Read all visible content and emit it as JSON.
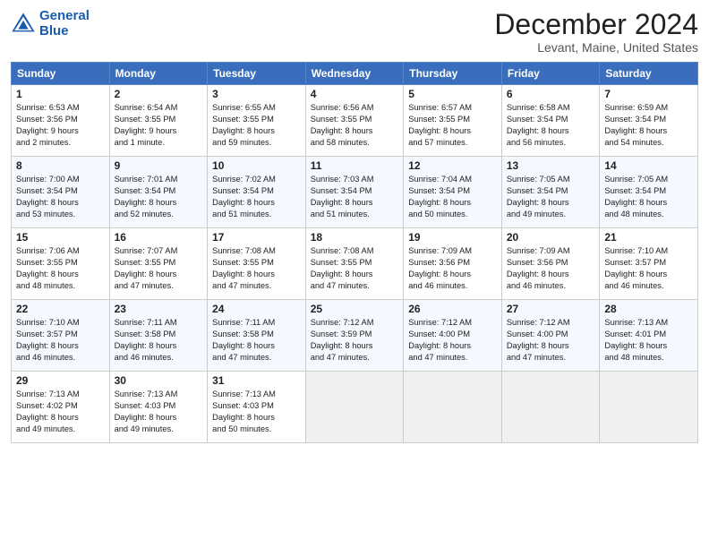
{
  "header": {
    "logo_line1": "General",
    "logo_line2": "Blue",
    "month": "December 2024",
    "location": "Levant, Maine, United States"
  },
  "days_of_week": [
    "Sunday",
    "Monday",
    "Tuesday",
    "Wednesday",
    "Thursday",
    "Friday",
    "Saturday"
  ],
  "weeks": [
    [
      {
        "day": "1",
        "info": "Sunrise: 6:53 AM\nSunset: 3:56 PM\nDaylight: 9 hours\nand 2 minutes.",
        "alt": false,
        "empty": false
      },
      {
        "day": "2",
        "info": "Sunrise: 6:54 AM\nSunset: 3:55 PM\nDaylight: 9 hours\nand 1 minute.",
        "alt": false,
        "empty": false
      },
      {
        "day": "3",
        "info": "Sunrise: 6:55 AM\nSunset: 3:55 PM\nDaylight: 8 hours\nand 59 minutes.",
        "alt": false,
        "empty": false
      },
      {
        "day": "4",
        "info": "Sunrise: 6:56 AM\nSunset: 3:55 PM\nDaylight: 8 hours\nand 58 minutes.",
        "alt": false,
        "empty": false
      },
      {
        "day": "5",
        "info": "Sunrise: 6:57 AM\nSunset: 3:55 PM\nDaylight: 8 hours\nand 57 minutes.",
        "alt": false,
        "empty": false
      },
      {
        "day": "6",
        "info": "Sunrise: 6:58 AM\nSunset: 3:54 PM\nDaylight: 8 hours\nand 56 minutes.",
        "alt": false,
        "empty": false
      },
      {
        "day": "7",
        "info": "Sunrise: 6:59 AM\nSunset: 3:54 PM\nDaylight: 8 hours\nand 54 minutes.",
        "alt": false,
        "empty": false
      }
    ],
    [
      {
        "day": "8",
        "info": "Sunrise: 7:00 AM\nSunset: 3:54 PM\nDaylight: 8 hours\nand 53 minutes.",
        "alt": true,
        "empty": false
      },
      {
        "day": "9",
        "info": "Sunrise: 7:01 AM\nSunset: 3:54 PM\nDaylight: 8 hours\nand 52 minutes.",
        "alt": true,
        "empty": false
      },
      {
        "day": "10",
        "info": "Sunrise: 7:02 AM\nSunset: 3:54 PM\nDaylight: 8 hours\nand 51 minutes.",
        "alt": true,
        "empty": false
      },
      {
        "day": "11",
        "info": "Sunrise: 7:03 AM\nSunset: 3:54 PM\nDaylight: 8 hours\nand 51 minutes.",
        "alt": true,
        "empty": false
      },
      {
        "day": "12",
        "info": "Sunrise: 7:04 AM\nSunset: 3:54 PM\nDaylight: 8 hours\nand 50 minutes.",
        "alt": true,
        "empty": false
      },
      {
        "day": "13",
        "info": "Sunrise: 7:05 AM\nSunset: 3:54 PM\nDaylight: 8 hours\nand 49 minutes.",
        "alt": true,
        "empty": false
      },
      {
        "day": "14",
        "info": "Sunrise: 7:05 AM\nSunset: 3:54 PM\nDaylight: 8 hours\nand 48 minutes.",
        "alt": true,
        "empty": false
      }
    ],
    [
      {
        "day": "15",
        "info": "Sunrise: 7:06 AM\nSunset: 3:55 PM\nDaylight: 8 hours\nand 48 minutes.",
        "alt": false,
        "empty": false
      },
      {
        "day": "16",
        "info": "Sunrise: 7:07 AM\nSunset: 3:55 PM\nDaylight: 8 hours\nand 47 minutes.",
        "alt": false,
        "empty": false
      },
      {
        "day": "17",
        "info": "Sunrise: 7:08 AM\nSunset: 3:55 PM\nDaylight: 8 hours\nand 47 minutes.",
        "alt": false,
        "empty": false
      },
      {
        "day": "18",
        "info": "Sunrise: 7:08 AM\nSunset: 3:55 PM\nDaylight: 8 hours\nand 47 minutes.",
        "alt": false,
        "empty": false
      },
      {
        "day": "19",
        "info": "Sunrise: 7:09 AM\nSunset: 3:56 PM\nDaylight: 8 hours\nand 46 minutes.",
        "alt": false,
        "empty": false
      },
      {
        "day": "20",
        "info": "Sunrise: 7:09 AM\nSunset: 3:56 PM\nDaylight: 8 hours\nand 46 minutes.",
        "alt": false,
        "empty": false
      },
      {
        "day": "21",
        "info": "Sunrise: 7:10 AM\nSunset: 3:57 PM\nDaylight: 8 hours\nand 46 minutes.",
        "alt": false,
        "empty": false
      }
    ],
    [
      {
        "day": "22",
        "info": "Sunrise: 7:10 AM\nSunset: 3:57 PM\nDaylight: 8 hours\nand 46 minutes.",
        "alt": true,
        "empty": false
      },
      {
        "day": "23",
        "info": "Sunrise: 7:11 AM\nSunset: 3:58 PM\nDaylight: 8 hours\nand 46 minutes.",
        "alt": true,
        "empty": false
      },
      {
        "day": "24",
        "info": "Sunrise: 7:11 AM\nSunset: 3:58 PM\nDaylight: 8 hours\nand 47 minutes.",
        "alt": true,
        "empty": false
      },
      {
        "day": "25",
        "info": "Sunrise: 7:12 AM\nSunset: 3:59 PM\nDaylight: 8 hours\nand 47 minutes.",
        "alt": true,
        "empty": false
      },
      {
        "day": "26",
        "info": "Sunrise: 7:12 AM\nSunset: 4:00 PM\nDaylight: 8 hours\nand 47 minutes.",
        "alt": true,
        "empty": false
      },
      {
        "day": "27",
        "info": "Sunrise: 7:12 AM\nSunset: 4:00 PM\nDaylight: 8 hours\nand 47 minutes.",
        "alt": true,
        "empty": false
      },
      {
        "day": "28",
        "info": "Sunrise: 7:13 AM\nSunset: 4:01 PM\nDaylight: 8 hours\nand 48 minutes.",
        "alt": true,
        "empty": false
      }
    ],
    [
      {
        "day": "29",
        "info": "Sunrise: 7:13 AM\nSunset: 4:02 PM\nDaylight: 8 hours\nand 49 minutes.",
        "alt": false,
        "empty": false
      },
      {
        "day": "30",
        "info": "Sunrise: 7:13 AM\nSunset: 4:03 PM\nDaylight: 8 hours\nand 49 minutes.",
        "alt": false,
        "empty": false
      },
      {
        "day": "31",
        "info": "Sunrise: 7:13 AM\nSunset: 4:03 PM\nDaylight: 8 hours\nand 50 minutes.",
        "alt": false,
        "empty": false
      },
      {
        "day": "",
        "info": "",
        "alt": false,
        "empty": true
      },
      {
        "day": "",
        "info": "",
        "alt": false,
        "empty": true
      },
      {
        "day": "",
        "info": "",
        "alt": false,
        "empty": true
      },
      {
        "day": "",
        "info": "",
        "alt": false,
        "empty": true
      }
    ]
  ]
}
